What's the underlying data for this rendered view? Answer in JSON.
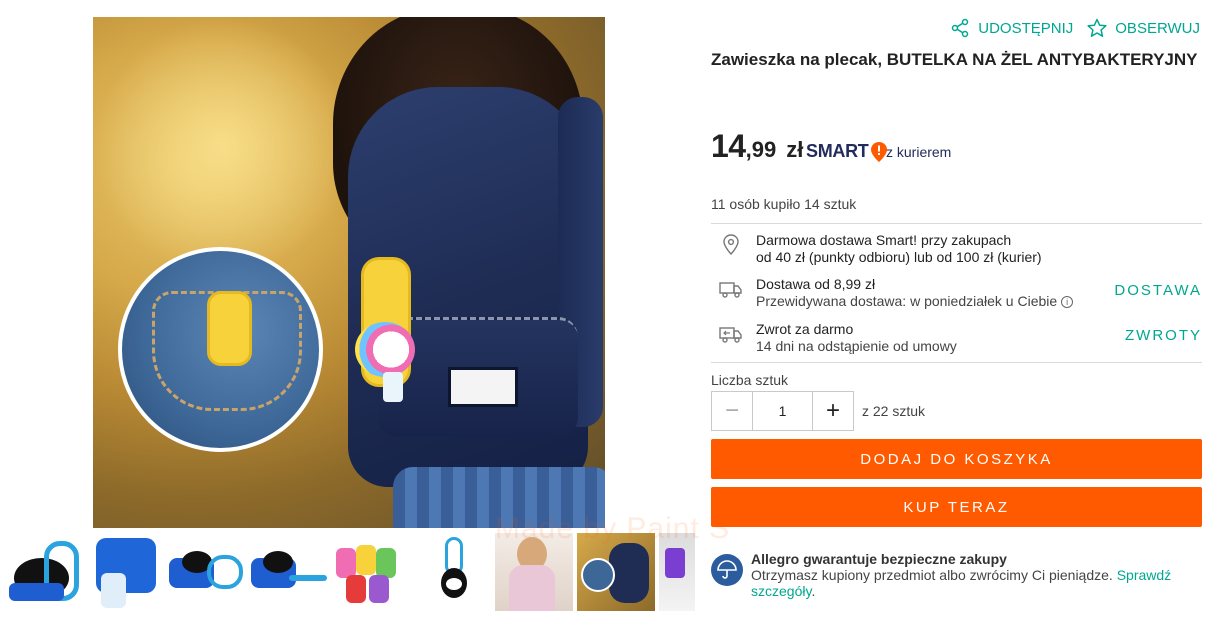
{
  "header": {
    "share_label": "UDOSTĘPNIJ",
    "observe_label": "OBSERWUJ"
  },
  "product": {
    "title": "Zawieszka na plecak, BUTELKA NA ŻEL ANTYBAKTERYJNY",
    "price_int": "14",
    "price_dec": ",99",
    "currency": "zł",
    "smart_label": "SMART",
    "courier_label": "z kurierem",
    "sold_text": "11 osób kupiło 14 sztuk"
  },
  "delivery": {
    "free_line1": "Darmowa dostawa Smart! przy zakupach",
    "free_line2": "od 40 zł (punkty odbioru) lub od 100 zł (kurier)",
    "cost_line1": "Dostawa od 8,99 zł",
    "cost_line2": "Przewidywana dostawa: w poniedziałek u Ciebie",
    "delivery_action": "DOSTAWA",
    "return_line1": "Zwrot za darmo",
    "return_line2": "14 dni na odstąpienie od umowy",
    "return_action": "ZWROTY"
  },
  "quantity": {
    "label": "Liczba sztuk",
    "minus": "−",
    "value": "1",
    "plus": "+",
    "available": "z 22 sztuk"
  },
  "actions": {
    "add_to_cart": "DODAJ DO KOSZYKA",
    "buy_now": "KUP TERAZ"
  },
  "guarantee": {
    "title": "Allegro gwarantuje bezpieczne zakupy",
    "text": "Otrzymasz kupiony przedmiot albo zwrócimy Ci pieniądze.",
    "link": "Sprawdź szczegóły",
    "link_suffix": "."
  },
  "colors": {
    "accent": "#ff5a00",
    "link": "#00a790",
    "smart_navy": "#222b5c"
  }
}
